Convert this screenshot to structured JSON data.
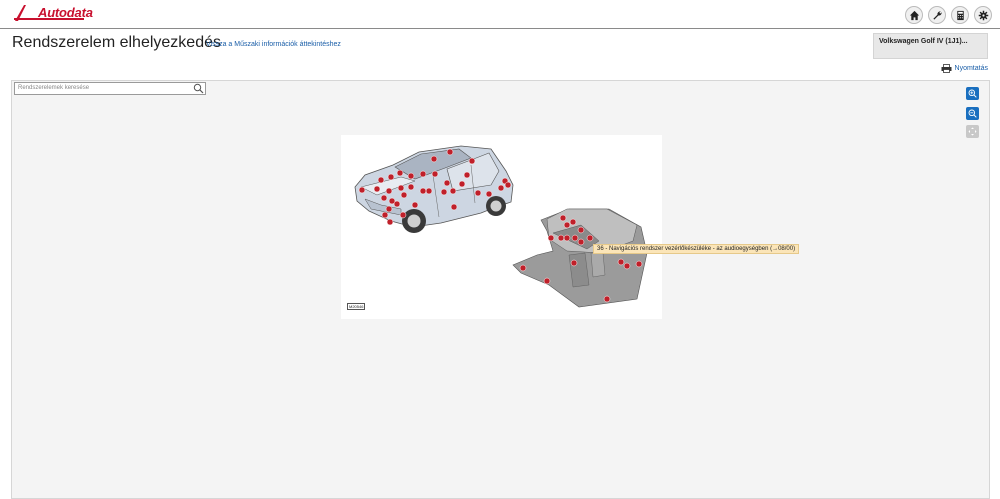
{
  "brand": {
    "logo_text": "Autodata",
    "accent": "#c8102e"
  },
  "header": {
    "title": "Rendszerelem elhelyezkedés",
    "back_link": "Vissza a Műszaki információk áttekintéshez",
    "vehicle": "Volkswagen Golf IV (1J1)...",
    "print_label": "Nyomtatás"
  },
  "top_icons": [
    "home-icon",
    "wrench-icon",
    "calculator-icon",
    "gear-icon"
  ],
  "search": {
    "placeholder": "Rendszerelemek keresése"
  },
  "zoom_controls": [
    "zoom-in-icon",
    "zoom-out-icon",
    "fit-icon"
  ],
  "diagram": {
    "id_label": "M20546",
    "tooltip": "36 - Navigációs rendszer vezérlőkészüléke - az audioegységben (→08/00)",
    "marker_color": "#c0202a"
  }
}
